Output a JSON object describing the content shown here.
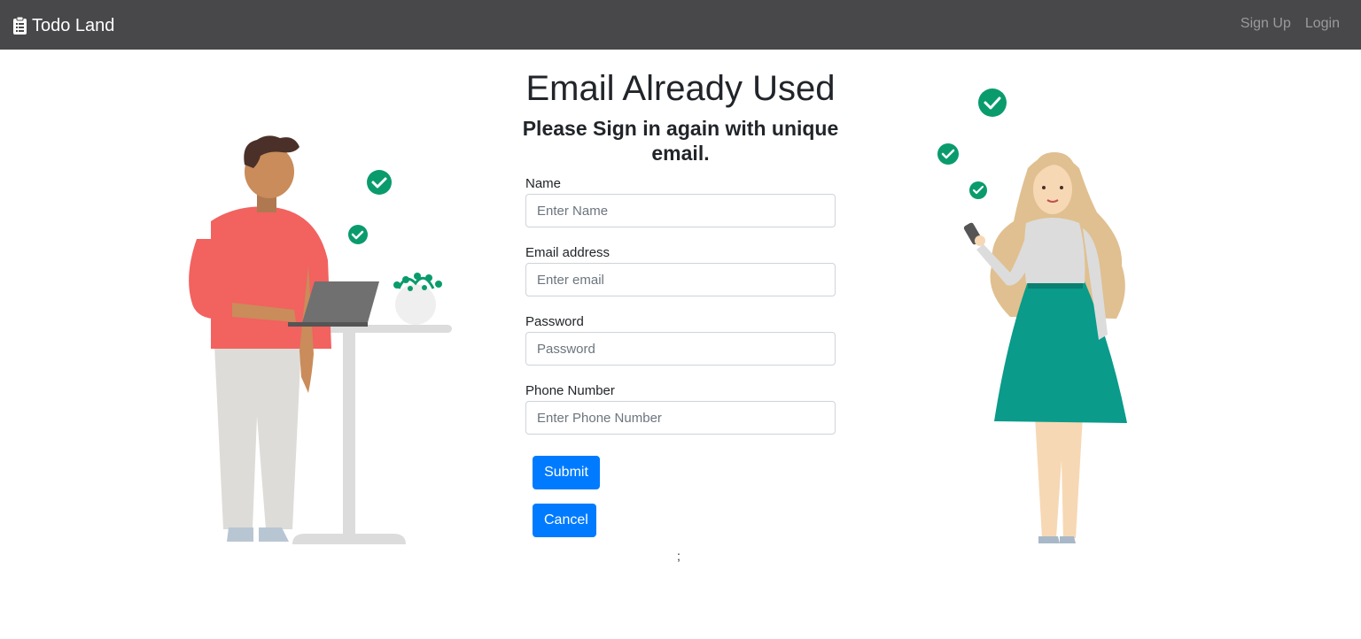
{
  "navbar": {
    "brand_icon": "clipboard-list-icon",
    "brand": "Todo Land",
    "links": [
      "Sign Up",
      "Login"
    ]
  },
  "main": {
    "title": "Email Already Used",
    "subtitle": "Please Sign in again with unique email.",
    "form": {
      "name": {
        "label": "Name",
        "placeholder": "Enter Name",
        "value": ""
      },
      "email": {
        "label": "Email address",
        "placeholder": "Enter email",
        "value": ""
      },
      "password": {
        "label": "Password",
        "placeholder": "Password",
        "value": ""
      },
      "phone": {
        "label": "Phone Number",
        "placeholder": "Enter Phone Number",
        "value": ""
      }
    },
    "submit_label": "Submit",
    "cancel_label": "Cancel",
    "stray_text": ";"
  },
  "colors": {
    "navbar_bg": "#48484a",
    "primary": "#007bff",
    "check_green": "#0a9b6c",
    "skirt_teal": "#0a9b8a",
    "shirt_coral": "#f2625f"
  }
}
